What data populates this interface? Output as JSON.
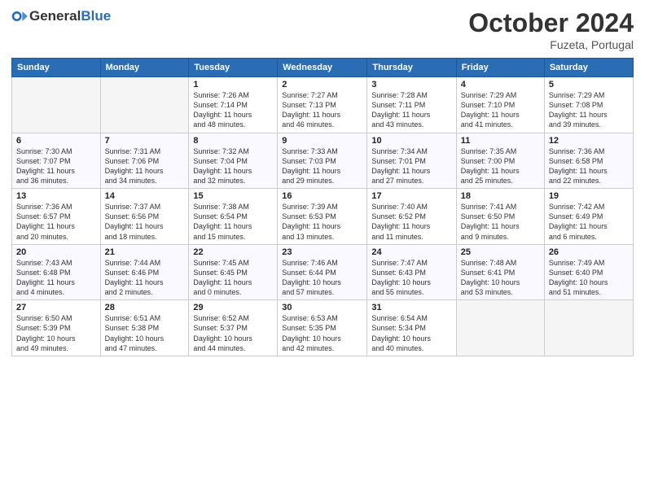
{
  "header": {
    "logo_general": "General",
    "logo_blue": "Blue",
    "month": "October 2024",
    "location": "Fuzeta, Portugal"
  },
  "days_of_week": [
    "Sunday",
    "Monday",
    "Tuesday",
    "Wednesday",
    "Thursday",
    "Friday",
    "Saturday"
  ],
  "weeks": [
    [
      {
        "day": "",
        "info": ""
      },
      {
        "day": "",
        "info": ""
      },
      {
        "day": "1",
        "info": "Sunrise: 7:26 AM\nSunset: 7:14 PM\nDaylight: 11 hours\nand 48 minutes."
      },
      {
        "day": "2",
        "info": "Sunrise: 7:27 AM\nSunset: 7:13 PM\nDaylight: 11 hours\nand 46 minutes."
      },
      {
        "day": "3",
        "info": "Sunrise: 7:28 AM\nSunset: 7:11 PM\nDaylight: 11 hours\nand 43 minutes."
      },
      {
        "day": "4",
        "info": "Sunrise: 7:29 AM\nSunset: 7:10 PM\nDaylight: 11 hours\nand 41 minutes."
      },
      {
        "day": "5",
        "info": "Sunrise: 7:29 AM\nSunset: 7:08 PM\nDaylight: 11 hours\nand 39 minutes."
      }
    ],
    [
      {
        "day": "6",
        "info": "Sunrise: 7:30 AM\nSunset: 7:07 PM\nDaylight: 11 hours\nand 36 minutes."
      },
      {
        "day": "7",
        "info": "Sunrise: 7:31 AM\nSunset: 7:06 PM\nDaylight: 11 hours\nand 34 minutes."
      },
      {
        "day": "8",
        "info": "Sunrise: 7:32 AM\nSunset: 7:04 PM\nDaylight: 11 hours\nand 32 minutes."
      },
      {
        "day": "9",
        "info": "Sunrise: 7:33 AM\nSunset: 7:03 PM\nDaylight: 11 hours\nand 29 minutes."
      },
      {
        "day": "10",
        "info": "Sunrise: 7:34 AM\nSunset: 7:01 PM\nDaylight: 11 hours\nand 27 minutes."
      },
      {
        "day": "11",
        "info": "Sunrise: 7:35 AM\nSunset: 7:00 PM\nDaylight: 11 hours\nand 25 minutes."
      },
      {
        "day": "12",
        "info": "Sunrise: 7:36 AM\nSunset: 6:58 PM\nDaylight: 11 hours\nand 22 minutes."
      }
    ],
    [
      {
        "day": "13",
        "info": "Sunrise: 7:36 AM\nSunset: 6:57 PM\nDaylight: 11 hours\nand 20 minutes."
      },
      {
        "day": "14",
        "info": "Sunrise: 7:37 AM\nSunset: 6:56 PM\nDaylight: 11 hours\nand 18 minutes."
      },
      {
        "day": "15",
        "info": "Sunrise: 7:38 AM\nSunset: 6:54 PM\nDaylight: 11 hours\nand 15 minutes."
      },
      {
        "day": "16",
        "info": "Sunrise: 7:39 AM\nSunset: 6:53 PM\nDaylight: 11 hours\nand 13 minutes."
      },
      {
        "day": "17",
        "info": "Sunrise: 7:40 AM\nSunset: 6:52 PM\nDaylight: 11 hours\nand 11 minutes."
      },
      {
        "day": "18",
        "info": "Sunrise: 7:41 AM\nSunset: 6:50 PM\nDaylight: 11 hours\nand 9 minutes."
      },
      {
        "day": "19",
        "info": "Sunrise: 7:42 AM\nSunset: 6:49 PM\nDaylight: 11 hours\nand 6 minutes."
      }
    ],
    [
      {
        "day": "20",
        "info": "Sunrise: 7:43 AM\nSunset: 6:48 PM\nDaylight: 11 hours\nand 4 minutes."
      },
      {
        "day": "21",
        "info": "Sunrise: 7:44 AM\nSunset: 6:46 PM\nDaylight: 11 hours\nand 2 minutes."
      },
      {
        "day": "22",
        "info": "Sunrise: 7:45 AM\nSunset: 6:45 PM\nDaylight: 11 hours\nand 0 minutes."
      },
      {
        "day": "23",
        "info": "Sunrise: 7:46 AM\nSunset: 6:44 PM\nDaylight: 10 hours\nand 57 minutes."
      },
      {
        "day": "24",
        "info": "Sunrise: 7:47 AM\nSunset: 6:43 PM\nDaylight: 10 hours\nand 55 minutes."
      },
      {
        "day": "25",
        "info": "Sunrise: 7:48 AM\nSunset: 6:41 PM\nDaylight: 10 hours\nand 53 minutes."
      },
      {
        "day": "26",
        "info": "Sunrise: 7:49 AM\nSunset: 6:40 PM\nDaylight: 10 hours\nand 51 minutes."
      }
    ],
    [
      {
        "day": "27",
        "info": "Sunrise: 6:50 AM\nSunset: 5:39 PM\nDaylight: 10 hours\nand 49 minutes."
      },
      {
        "day": "28",
        "info": "Sunrise: 6:51 AM\nSunset: 5:38 PM\nDaylight: 10 hours\nand 47 minutes."
      },
      {
        "day": "29",
        "info": "Sunrise: 6:52 AM\nSunset: 5:37 PM\nDaylight: 10 hours\nand 44 minutes."
      },
      {
        "day": "30",
        "info": "Sunrise: 6:53 AM\nSunset: 5:35 PM\nDaylight: 10 hours\nand 42 minutes."
      },
      {
        "day": "31",
        "info": "Sunrise: 6:54 AM\nSunset: 5:34 PM\nDaylight: 10 hours\nand 40 minutes."
      },
      {
        "day": "",
        "info": ""
      },
      {
        "day": "",
        "info": ""
      }
    ]
  ]
}
